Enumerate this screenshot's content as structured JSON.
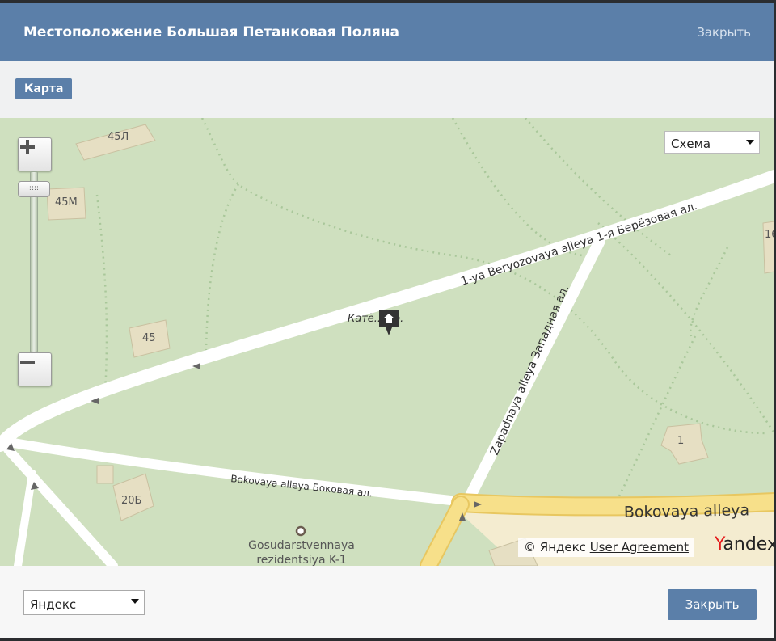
{
  "header": {
    "title": "Местоположение Большая Петанковая Поляна",
    "close_link": "Закрыть"
  },
  "tabs": [
    {
      "label": "Карта",
      "active": true
    }
  ],
  "map": {
    "type_selector": {
      "selected": "Схема"
    },
    "zoom": {
      "plus": "+",
      "minus": "−",
      "handle": "::::"
    },
    "place_label": "Катё... Ро.",
    "labels": {
      "b45l": "45Л",
      "b45m": "45М",
      "b45": "45",
      "b20b": "20Б",
      "b1": "1",
      "b16": "16",
      "road1": "1-ya Beryozovaya alleya  1-я Берёзовая ал.",
      "road2": "Zapadnaya alleya  Западная ал.",
      "road3": "Bokovaya alleya  Боковая ал.",
      "road4": "Bokovaya alleya",
      "poi1": "Gosudarstvennaya",
      "poi2": "rezidentsiya K-1"
    },
    "copyright": {
      "prefix": "© Яндекс",
      "agreement": "User Agreement"
    },
    "logo": {
      "first": "Y",
      "rest": "andex"
    },
    "icons": {
      "marker": "house-marker-icon",
      "poi": "poi-circle-icon"
    }
  },
  "footer": {
    "provider": "Яндекс",
    "close_button": "Закрыть"
  },
  "colors": {
    "header": "#5b7fa9",
    "map_bg": "#cfe0bf",
    "road": "#ffffff",
    "main_road": "#f6dc7a",
    "building": "#e6dfc3"
  }
}
